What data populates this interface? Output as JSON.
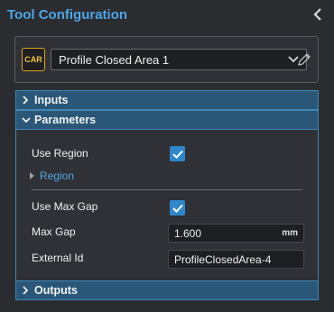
{
  "panel": {
    "title": "Tool Configuration"
  },
  "tool": {
    "badge": "CAR",
    "selected": "Profile Closed Area 1"
  },
  "sections": {
    "inputs": "Inputs",
    "parameters": "Parameters",
    "outputs": "Outputs"
  },
  "parameters": {
    "use_region_label": "Use Region",
    "use_region_checked": true,
    "region_link": "Region",
    "use_max_gap_label": "Use Max Gap",
    "use_max_gap_checked": true,
    "max_gap_label": "Max Gap",
    "max_gap_value": "1.600",
    "max_gap_unit": "mm",
    "external_id_label": "External Id",
    "external_id_value": "ProfileClosedArea-4"
  },
  "colors": {
    "accent": "#4ea6e6",
    "section_bg": "#2a5777",
    "checkbox": "#2f86c9",
    "badge_border": "#e0a020"
  }
}
